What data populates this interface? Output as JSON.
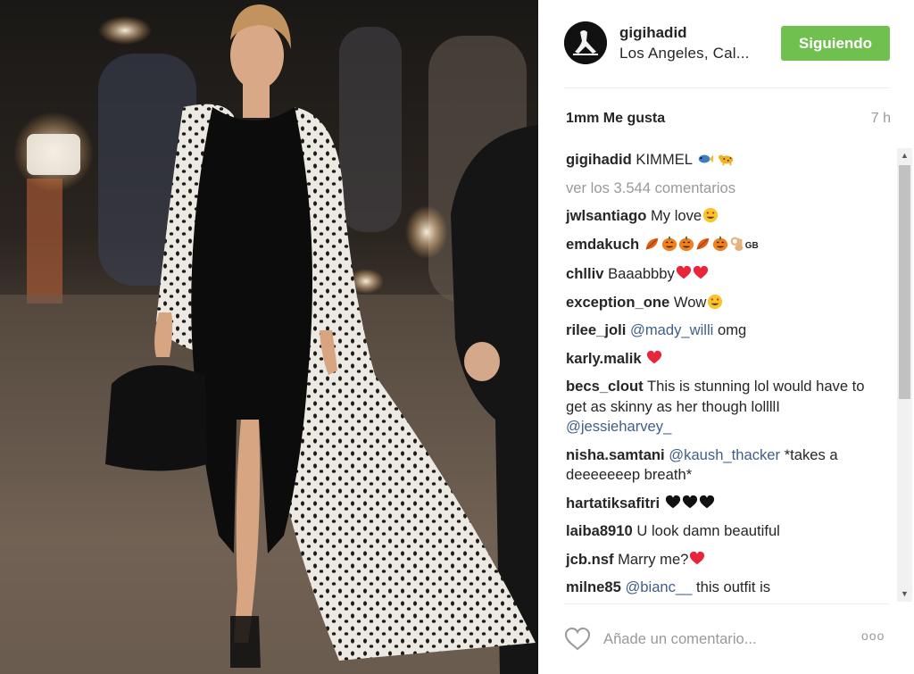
{
  "post": {
    "username": "gigihadid",
    "location": "Los Angeles, Cal...",
    "follow_label": "Siguiendo",
    "likes": "1mm Me gusta",
    "time_ago": "7 h"
  },
  "caption": {
    "user": "gigihadid",
    "text": "KIMMEL",
    "emojis": [
      "fish-emoji",
      "leopard-emoji"
    ]
  },
  "load_more": "ver los 3.544 comentarios",
  "comments": [
    {
      "user": "jwlsantiago",
      "text": "My love",
      "emojis": [
        "heart-eyes-emoji"
      ]
    },
    {
      "user": "emdakuch",
      "text": "",
      "emojis": [
        "fallen-leaf-emoji",
        "jack-o-lantern-emoji",
        "jack-o-lantern-emoji",
        "fallen-leaf-emoji",
        "jack-o-lantern-emoji",
        "ok-hand-emoji"
      ],
      "suffix": "GB"
    },
    {
      "user": "chlliv",
      "text": "Baaabbby",
      "emojis": [
        "heart-emoji",
        "heart-emoji"
      ]
    },
    {
      "user": "exception_one",
      "text": "Wow",
      "emojis": [
        "heart-eyes-emoji"
      ]
    },
    {
      "user": "rilee_joli",
      "mention": "@mady_willi",
      "text": "omg",
      "emojis": []
    },
    {
      "user": "karly.malik",
      "text": "",
      "emojis": [
        "heart-emoji"
      ]
    },
    {
      "user": "becs_clout",
      "text": "This is stunning lol would have to get as skinny as her though lollllI",
      "mention_after": "@jessieharvey_",
      "emojis": []
    },
    {
      "user": "nisha.samtani",
      "mention": "@kaush_thacker",
      "text": "*takes a deeeeeeep breath*",
      "emojis": []
    },
    {
      "user": "hartatiksafitri",
      "text": "",
      "emojis": [
        "black-heart-emoji",
        "black-heart-emoji",
        "black-heart-emoji"
      ]
    },
    {
      "user": "laiba8910",
      "text": "U look damn beautiful",
      "emojis": []
    },
    {
      "user": "jcb.nsf",
      "text": "Marry me?",
      "emojis": [
        "heart-emoji"
      ]
    },
    {
      "user": "milne85",
      "mention": "@bianc__",
      "text": "this outfit is",
      "emojis": []
    }
  ],
  "add_comment": {
    "placeholder": "Añade un comentario..."
  },
  "more_label": "ooo",
  "colors": {
    "follow_green": "#70c050",
    "mention_blue": "#3f5f88",
    "muted": "#999999",
    "heart_red": "#e8253b"
  },
  "icons": {
    "like": "heart-outline-icon",
    "more": "more-options-icon",
    "scroll_up": "scroll-up-arrow",
    "scroll_down": "scroll-down-arrow"
  }
}
